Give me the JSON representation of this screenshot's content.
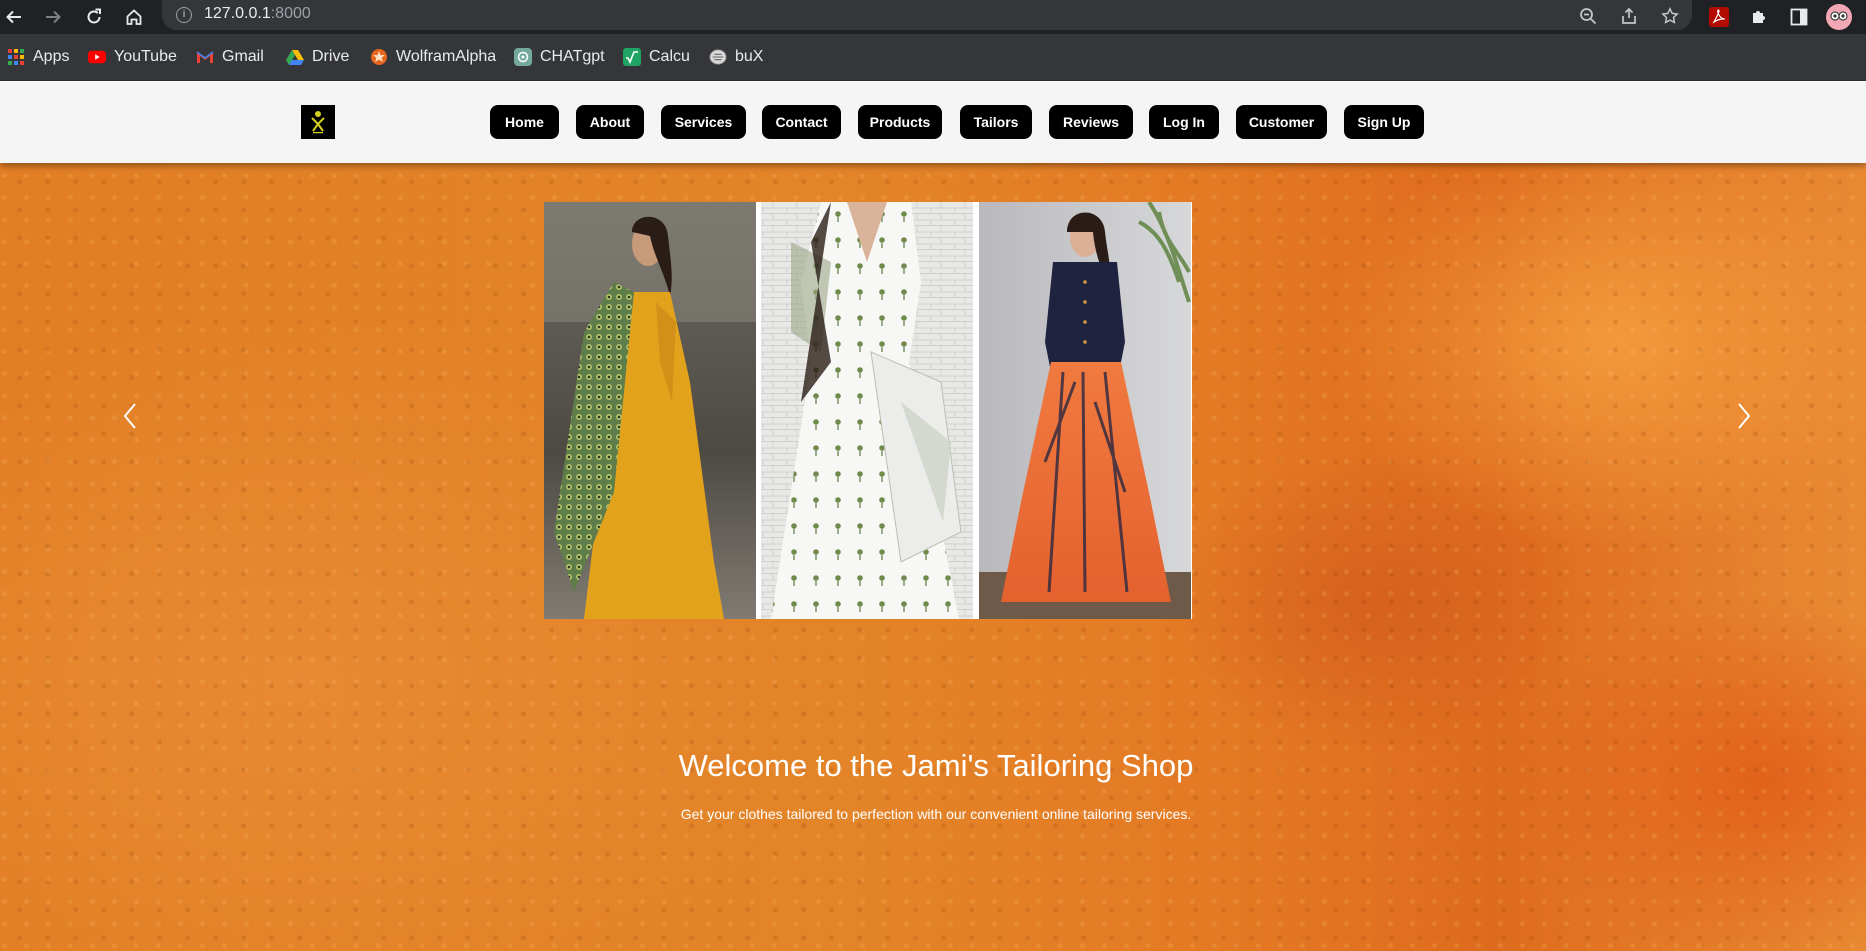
{
  "browser": {
    "url_host": "127.0.0.1",
    "url_port": ":8000"
  },
  "bookmarks": [
    {
      "label": "Apps",
      "icon": "apps-grid-icon"
    },
    {
      "label": "YouTube",
      "icon": "youtube-icon"
    },
    {
      "label": "Gmail",
      "icon": "gmail-icon"
    },
    {
      "label": "Drive",
      "icon": "drive-icon"
    },
    {
      "label": "WolframAlpha",
      "icon": "wolframalpha-icon"
    },
    {
      "label": "CHATgpt",
      "icon": "chatgpt-icon"
    },
    {
      "label": "Calcu",
      "icon": "calculator-icon"
    },
    {
      "label": "buX",
      "icon": "bux-icon"
    }
  ],
  "site": {
    "nav": [
      "Home",
      "About",
      "Services",
      "Contact",
      "Products",
      "Tailors",
      "Reviews",
      "Log In",
      "Customer",
      "Sign Up"
    ],
    "hero_title": "Welcome to the Jami's Tailoring Shop",
    "hero_subtitle": "Get your clothes tailored to perfection with our convenient online tailoring services."
  },
  "colors": {
    "nav_pill": "#000000",
    "header_bg": "#f5f5f5",
    "page_bg": "#e38428",
    "browser_bg": "#202124"
  }
}
